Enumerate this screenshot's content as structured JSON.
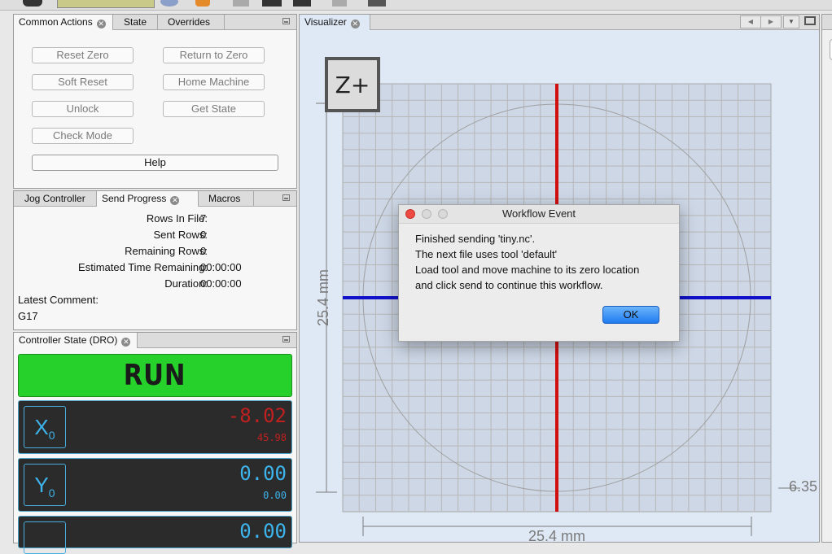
{
  "colors": {
    "run_bg": "#26d12b",
    "dro_negative": "#c0201f",
    "dro_value": "#3db4ec",
    "spindle_x": "#d20f0f",
    "spindle_y": "#1010c8"
  },
  "top_panel": {
    "tabs": [
      {
        "label": "Common Actions",
        "closable": true
      },
      {
        "label": "State"
      },
      {
        "label": "Overrides"
      }
    ],
    "buttons": {
      "reset_zero": "Reset Zero",
      "return_to_zero": "Return to Zero",
      "soft_reset": "Soft Reset",
      "home_machine": "Home Machine",
      "unlock": "Unlock",
      "get_state": "Get State",
      "check_mode": "Check Mode",
      "help": "Help"
    }
  },
  "progress_panel": {
    "tabs": [
      {
        "label": "Jog Controller"
      },
      {
        "label": "Send Progress",
        "closable": true
      },
      {
        "label": "Macros"
      }
    ],
    "rows": [
      {
        "label": "Rows In File:",
        "value": "7"
      },
      {
        "label": "Sent Rows:",
        "value": "0"
      },
      {
        "label": "Remaining Rows:",
        "value": "0"
      },
      {
        "label": "Estimated Time Remaining:",
        "value": "00:00:00"
      },
      {
        "label": "Duration:",
        "value": "00:00:00"
      }
    ],
    "latest_comment_label": "Latest Comment:",
    "latest_comment": "G17"
  },
  "dro_panel": {
    "tab": "Controller State (DRO)",
    "state": "RUN",
    "axes": [
      {
        "axis": "X",
        "sub": "0",
        "work": "-8.02",
        "machine": "45.98"
      },
      {
        "axis": "Y",
        "sub": "0",
        "work": "0.00",
        "machine": "0.00"
      },
      {
        "work": "0.00"
      }
    ]
  },
  "visualizer": {
    "tab": "Visualizer",
    "view_label": "Z+",
    "y_dimension": "25.4 mm",
    "x_dimension": "25.4 mm",
    "side_label": "6.35"
  },
  "dialog": {
    "title": "Workflow Event",
    "lines": [
      "Finished sending 'tiny.nc'.",
      "The next file uses tool 'default'",
      "Load tool and move machine to its zero location",
      "and click send to continue this workflow."
    ],
    "ok": "OK"
  }
}
